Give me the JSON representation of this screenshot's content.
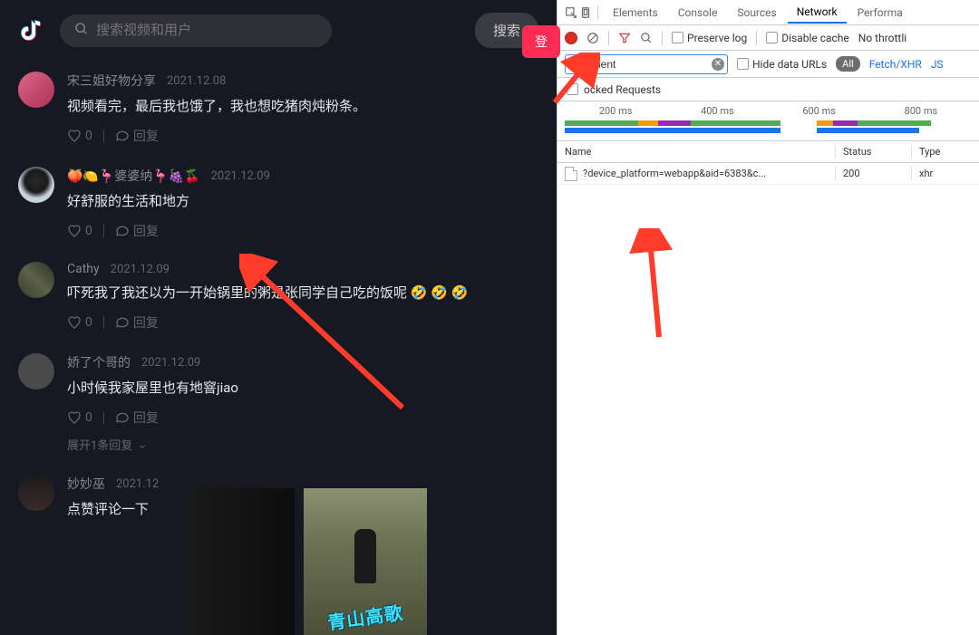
{
  "header": {
    "search_placeholder": "搜索视频和用户",
    "search_btn": "搜索",
    "login_btn": "登"
  },
  "comments": [
    {
      "username": "宋三姐好物分享",
      "date": "2021.12.08",
      "text": "视频看完，最后我也饿了，我也想吃猪肉炖粉条。",
      "likes": "0",
      "reply": "回复"
    },
    {
      "username": "🍑🍋🦩婆婆纳🦩🍇🍒",
      "date": "2021.12.09",
      "text": "好舒服的生活和地方",
      "likes": "0",
      "reply": "回复"
    },
    {
      "username": "Cathy",
      "date": "2021.12.09",
      "text": "吓死我了我还以为一开始锅里的粥是张同学自己吃的饭呢 🤣 🤣 🤣",
      "likes": "0",
      "reply": "回复"
    },
    {
      "username": "娇了个哥的",
      "date": "2021.12.09",
      "text": "小时候我家屋里也有地窨jiao",
      "likes": "0",
      "reply": "回复",
      "expand": "展开1条回复"
    },
    {
      "username": "妙妙巫",
      "date": "2021.12",
      "text": "点赞评论一下",
      "likes": "",
      "reply": ""
    }
  ],
  "video_thumb_text": "青山高歌",
  "devtools": {
    "tabs": [
      "Elements",
      "Console",
      "Sources",
      "Network",
      "Performa"
    ],
    "active_tab": "Network",
    "preserve_log": "Preserve log",
    "disable_cache": "Disable cache",
    "no_throttling": "No throttli",
    "filter_value": "comment",
    "hide_urls": "Hide data URLs",
    "filter_all": "All",
    "filter_fetch": "Fetch/XHR",
    "filter_js": "JS",
    "blocked": "ocked Requests",
    "time_labels": [
      "200 ms",
      "400 ms",
      "600 ms",
      "800 ms"
    ],
    "table_headers": {
      "name": "Name",
      "status": "Status",
      "type": "Type"
    },
    "rows": [
      {
        "name": "?device_platform=webapp&aid=6383&c...",
        "status": "200",
        "type": "xhr"
      }
    ]
  }
}
